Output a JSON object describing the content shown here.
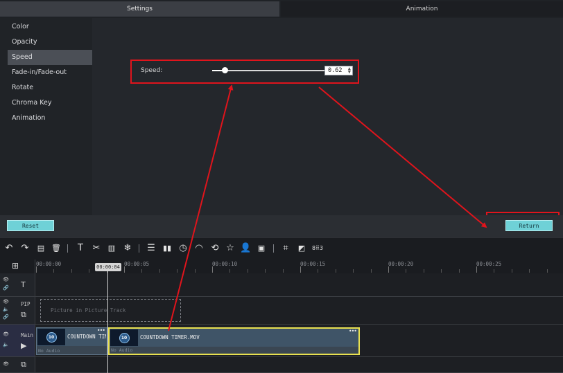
{
  "tabs": [
    {
      "label": "Settings",
      "active": true
    },
    {
      "label": "Animation",
      "active": false
    }
  ],
  "settings_nav": {
    "items": [
      "Color",
      "Opacity",
      "Speed",
      "Fade-in/Fade-out",
      "Rotate",
      "Chroma Key",
      "Animation"
    ],
    "selected": "Speed"
  },
  "speed": {
    "label": "Speed:",
    "value": "0.62",
    "slider_fraction": 0.11
  },
  "buttons": {
    "reset": "Reset",
    "return": "Return"
  },
  "toolbar": {
    "icons": [
      "undo-icon",
      "redo-icon",
      "paste-icon",
      "delete-icon",
      "text-icon",
      "cut-icon",
      "split-icon",
      "freeze-icon",
      "adjust-icon",
      "audio-bars-icon",
      "clock-icon",
      "speed-icon",
      "transition-icon",
      "star-icon",
      "person-icon",
      "record-icon",
      "crop-icon",
      "mosaic-icon",
      "grid-icon"
    ],
    "extra_label": "8⠿3"
  },
  "timeline": {
    "ticks": [
      "00:00:00",
      "00:00:05",
      "00:00:10",
      "00:00:15",
      "00:00:20",
      "00:00:25"
    ],
    "playhead": "00:00:04"
  },
  "tracks": {
    "pip_label": "PIP",
    "main_label": "Main",
    "pip_placeholder": "Picture in Picture Track",
    "clips": [
      {
        "title": "COUNTDOWN TIM",
        "audio": "No Audio",
        "thumb": "10"
      },
      {
        "title": "COUNTDOWN TIMER.MOV",
        "audio": "No Audio",
        "thumb": "10"
      }
    ]
  },
  "colors": {
    "accent_button": "#6fd1d7",
    "annotation": "#e0141c",
    "selected_clip_border": "#e8e050"
  }
}
